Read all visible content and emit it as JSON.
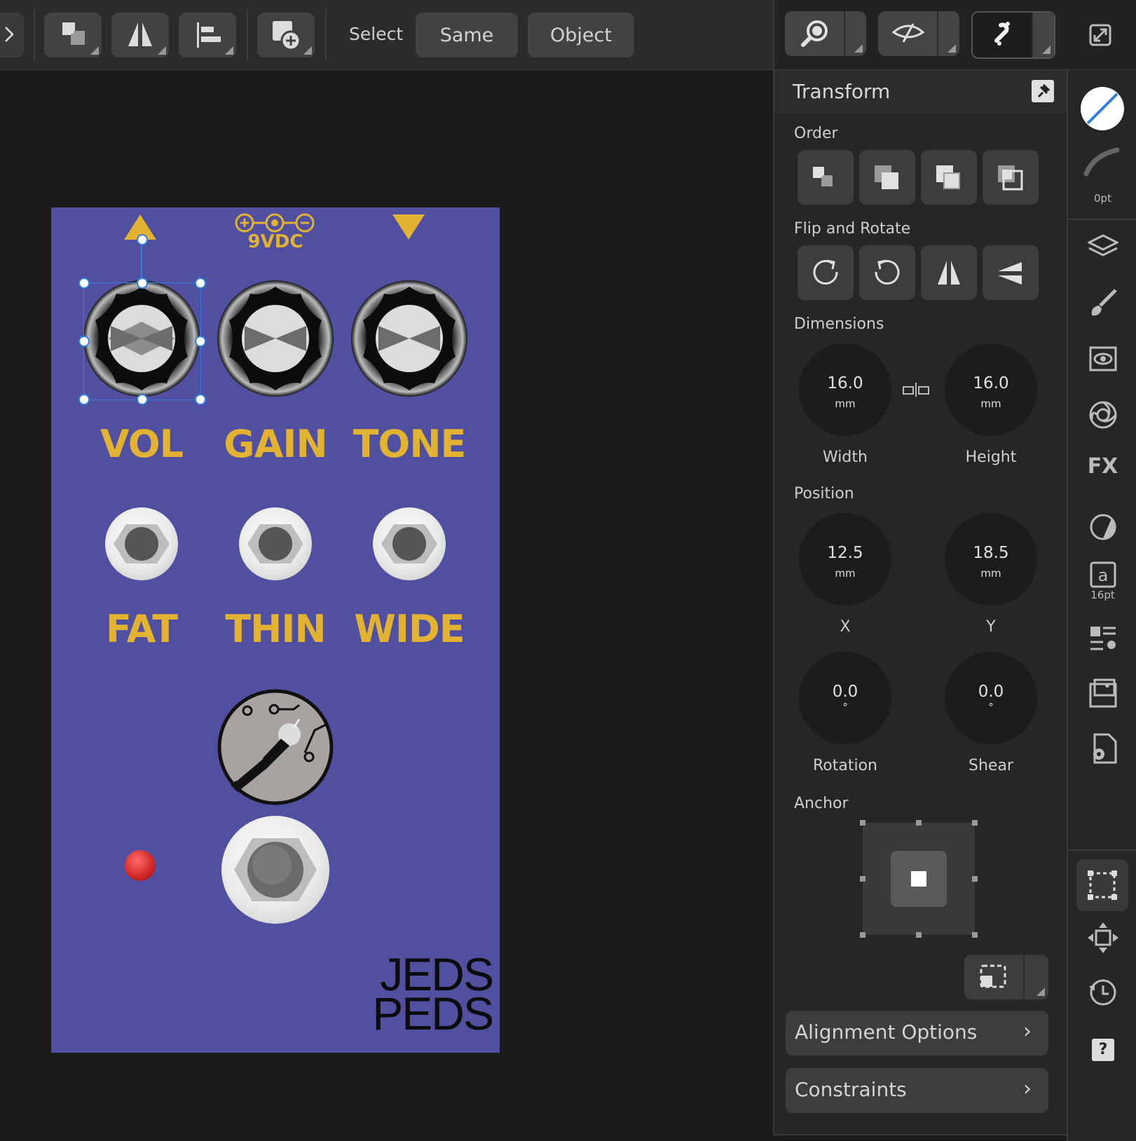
{
  "toolbar": {
    "select_label": "Select",
    "same_label": "Same",
    "object_label": "Object"
  },
  "panel": {
    "title": "Transform",
    "order_label": "Order",
    "flip_label": "Flip and Rotate",
    "dimensions_label": "Dimensions",
    "width": {
      "value": "16.0",
      "unit": "mm",
      "label": "Width"
    },
    "height": {
      "value": "16.0",
      "unit": "mm",
      "label": "Height"
    },
    "position_label": "Position",
    "x": {
      "value": "12.5",
      "unit": "mm",
      "label": "X"
    },
    "y": {
      "value": "18.5",
      "unit": "mm",
      "label": "Y"
    },
    "rotation": {
      "value": "0.0",
      "unit": "°",
      "label": "Rotation"
    },
    "shear": {
      "value": "0.0",
      "unit": "°",
      "label": "Shear"
    },
    "anchor_label": "Anchor",
    "alignment_options": "Alignment Options",
    "constraints": "Constraints"
  },
  "studio": {
    "stroke_width": "0pt",
    "text_size": "16pt"
  },
  "pedal": {
    "top_label": "9VDC",
    "knob_labels": [
      "VOL",
      "GAIN",
      "TONE"
    ],
    "switch_labels": [
      "FAT",
      "THIN",
      "WIDE"
    ],
    "brand_line1": "JEDS",
    "brand_line2": "PEDS",
    "body_color": "#5150a0",
    "label_color": "#e2b232"
  },
  "colors": {
    "accent_selection": "#2f7fe0",
    "led": "#d42b2b"
  }
}
